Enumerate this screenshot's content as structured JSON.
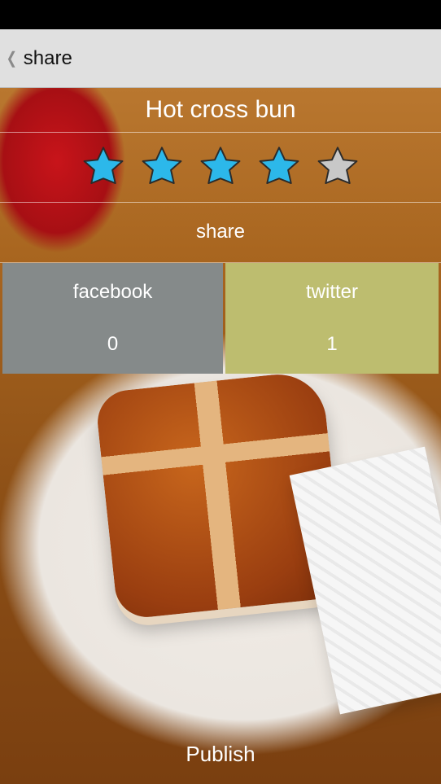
{
  "action_bar": {
    "title": "share",
    "back_icon": "chevron-left-icon"
  },
  "item": {
    "title": "Hot cross bun",
    "rating": 4,
    "max_rating": 5
  },
  "share_section": {
    "label": "share"
  },
  "networks": [
    {
      "name": "facebook",
      "count": "0",
      "color": "#858a8a"
    },
    {
      "name": "twitter",
      "count": "1",
      "color": "#bdbd6f"
    }
  ],
  "footer": {
    "publish_label": "Publish"
  },
  "colors": {
    "star_filled": "#2cb8ea",
    "star_empty": "#c8c8c8"
  }
}
